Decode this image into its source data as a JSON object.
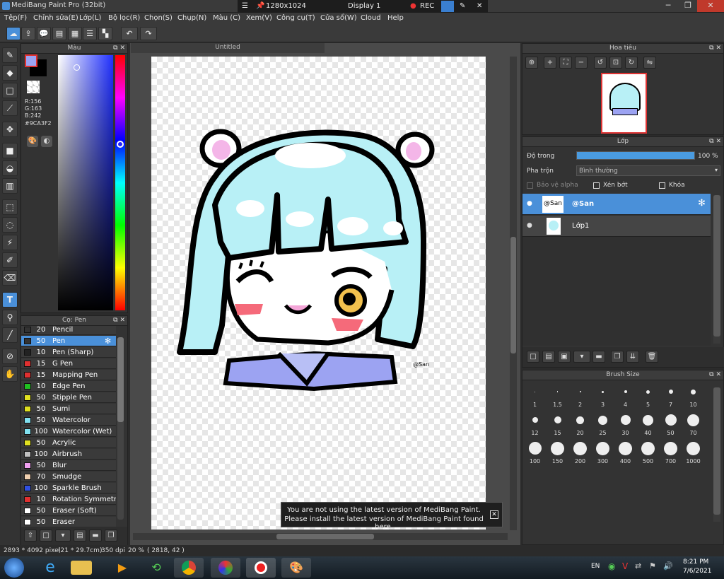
{
  "window": {
    "title": "MediBang Paint Pro (32bit)",
    "min": "─",
    "max": "❐",
    "close": "✕"
  },
  "rec_toolbar": {
    "resolution": "1280x1024",
    "display": "Display 1",
    "rec": "REC"
  },
  "menu": [
    "Tệp(F)",
    "Chỉnh sửa(E)",
    "Lớp(L)",
    "Bộ lọc(R)",
    "Chọn(S)",
    "Chụp(N)",
    "Màu (C)",
    "Xem(V)",
    "Công cụ(T)",
    "Cửa sổ(W)",
    "Cloud",
    "Help"
  ],
  "color_panel": {
    "title": "Màu",
    "r": "R:156",
    "g": "G:163",
    "b": "B:242",
    "hex": "#9CA3F2",
    "fg": "#9CA3F2",
    "bg": "#000000"
  },
  "brush_panel": {
    "title": "Cọ: Pen",
    "items": [
      {
        "size": "20",
        "name": "Pencil",
        "color": "#333333"
      },
      {
        "size": "50",
        "name": "Pen",
        "color": "#333333",
        "selected": true
      },
      {
        "size": "10",
        "name": "Pen (Sharp)",
        "color": "#222222"
      },
      {
        "size": "15",
        "name": "G Pen",
        "color": "#e03030"
      },
      {
        "size": "15",
        "name": "Mapping Pen",
        "color": "#e03030"
      },
      {
        "size": "10",
        "name": "Edge Pen",
        "color": "#20c020"
      },
      {
        "size": "50",
        "name": "Stipple Pen",
        "color": "#e0e020"
      },
      {
        "size": "50",
        "name": "Sumi",
        "color": "#e0e020"
      },
      {
        "size": "50",
        "name": "Watercolor",
        "color": "#80e0f0"
      },
      {
        "size": "100",
        "name": "Watercolor (Wet)",
        "color": "#80e0f0"
      },
      {
        "size": "50",
        "name": "Acrylic",
        "color": "#e0e020"
      },
      {
        "size": "100",
        "name": "Airbrush",
        "color": "#c0c0c0"
      },
      {
        "size": "50",
        "name": "Blur",
        "color": "#f0a0f0"
      },
      {
        "size": "70",
        "name": "Smudge",
        "color": "#f0d0b0"
      },
      {
        "size": "100",
        "name": "Sparkle Brush",
        "color": "#3050e0"
      },
      {
        "size": "10",
        "name": "Rotation Symmetry P",
        "color": "#e03030"
      },
      {
        "size": "50",
        "name": "Eraser (Soft)",
        "color": "#ffffff"
      },
      {
        "size": "50",
        "name": "Eraser",
        "color": "#ffffff"
      }
    ]
  },
  "canvas": {
    "tab": "Untitled",
    "watermark": "@San"
  },
  "navigator": {
    "title": "Hoa tiêu"
  },
  "layer_panel": {
    "title": "Lớp",
    "opacity_label": "Độ trong",
    "opacity_value": "100 %",
    "opacity": 1.0,
    "blend_label": "Pha trộn",
    "blend_value": "Bình thường",
    "protect_alpha": "Bảo vệ alpha",
    "clipping": "Xén bớt",
    "lock": "Khóa",
    "layers": [
      {
        "name": "@San",
        "thumb": "@San",
        "selected": true
      },
      {
        "name": "Lớp1",
        "selected": false
      }
    ]
  },
  "brush_size_panel": {
    "title": "Brush Size",
    "sizes": [
      "1",
      "1.5",
      "2",
      "3",
      "4",
      "5",
      "7",
      "10",
      "12",
      "15",
      "20",
      "25",
      "30",
      "40",
      "50",
      "70",
      "100",
      "150",
      "200",
      "300",
      "400",
      "500",
      "700",
      "1000"
    ]
  },
  "notice": {
    "line1": "You are not using the latest version of MediBang Paint.",
    "line2": "Please install the latest version of MediBang Paint found here."
  },
  "status": {
    "size": "2893 * 4092 pixel",
    "paper": "(21 * 29.7cm)",
    "dpi": "350 dpi",
    "zoom": "20 %",
    "coords": "( 2818, 42 )"
  },
  "taskbar": {
    "lang": "EN",
    "time": "8:21 PM",
    "date": "7/6/2021"
  }
}
